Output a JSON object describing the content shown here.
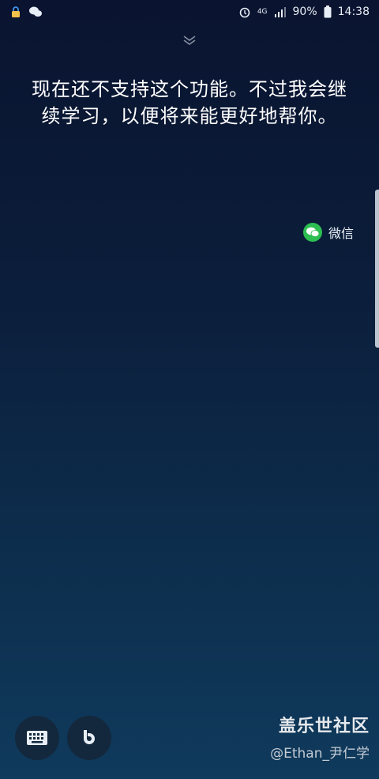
{
  "status_bar": {
    "left_icons": [
      "lock-notification-icon",
      "wechat-notification-icon"
    ],
    "network": "4G",
    "battery": "90%",
    "time": "14:38"
  },
  "message": "现在还不支持这个功能。不过我会继续学习，以便将来能更好地帮你。",
  "app_chip": {
    "label": "微信",
    "icon": "wechat-icon"
  },
  "bottom": {
    "keyboard_icon": "keyboard-icon",
    "bixby_icon": "bixby-icon"
  },
  "watermark": {
    "title": "盖乐世社区",
    "author": "@Ethan_尹仁学"
  },
  "colors": {
    "wechat_green": "#2dbe51",
    "bg_top": "#0a1430",
    "bg_bottom": "#0f3a5c"
  }
}
